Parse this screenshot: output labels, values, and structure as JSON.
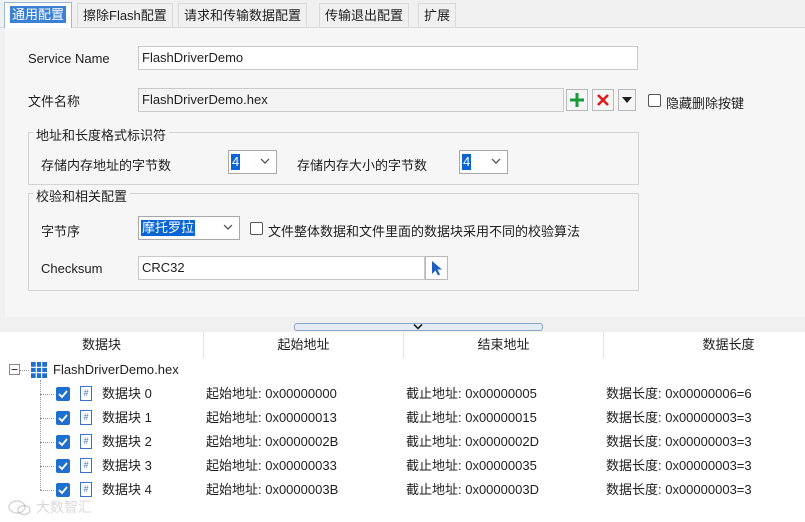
{
  "tabs": [
    "通用配置",
    "擦除Flash配置",
    "请求和传输数据配置",
    "传输退出配置",
    "扩展"
  ],
  "form": {
    "service_name_label": "Service Name",
    "service_name_value": "FlashDriverDemo",
    "file_name_label": "文件名称",
    "file_name_value": "FlashDriverDemo.hex",
    "hide_delete_label": "隐藏删除按键",
    "address_group_title": "地址和长度格式标识符",
    "addr_bytes_label": "存储内存地址的字节数",
    "addr_bytes_value": "4",
    "size_bytes_label": "存储内存大小的字节数",
    "size_bytes_value": "4",
    "checksum_group_title": "校验和相关配置",
    "byte_order_label": "字节序",
    "byte_order_value": "摩托罗拉",
    "different_checksum_label": "文件整体数据和文件里面的数据块采用不同的校验算法",
    "checksum_label": "Checksum",
    "checksum_value": "CRC32"
  },
  "tree": {
    "columns": [
      "数据块",
      "起始地址",
      "结束地址",
      "数据长度"
    ],
    "root": "FlashDriverDemo.hex",
    "rows": [
      {
        "name": "数据块 0",
        "start": "起始地址: 0x00000000",
        "end": "截止地址: 0x00000005",
        "length": "数据长度: 0x00000006=6"
      },
      {
        "name": "数据块 1",
        "start": "起始地址: 0x00000013",
        "end": "截止地址: 0x00000015",
        "length": "数据长度: 0x00000003=3"
      },
      {
        "name": "数据块 2",
        "start": "起始地址: 0x0000002B",
        "end": "截止地址: 0x0000002D",
        "length": "数据长度: 0x00000003=3"
      },
      {
        "name": "数据块 3",
        "start": "起始地址: 0x00000033",
        "end": "截止地址: 0x00000035",
        "length": "数据长度: 0x00000003=3"
      },
      {
        "name": "数据块 4",
        "start": "起始地址: 0x0000003B",
        "end": "截止地址: 0x0000003D",
        "length": "数据长度: 0x00000003=3"
      }
    ]
  },
  "watermark": "大数智汇"
}
